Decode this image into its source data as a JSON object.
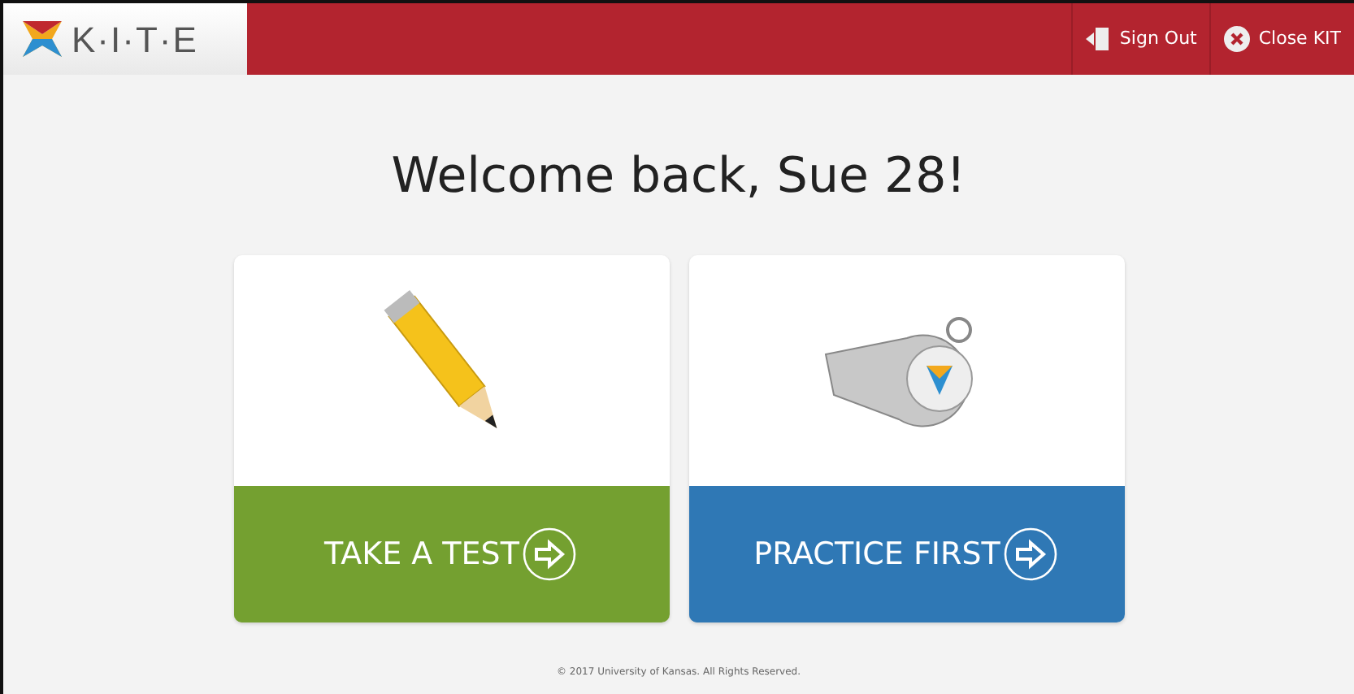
{
  "header": {
    "logo_text": "K·I·T·E",
    "actions": [
      {
        "kind": "signout",
        "label": "Sign Out"
      },
      {
        "kind": "close",
        "label": "Close KIT"
      }
    ]
  },
  "welcome": "Welcome back, Sue 28!",
  "cards": [
    {
      "kind": "pencil",
      "label": "TAKE A TEST",
      "color": "#74a030"
    },
    {
      "kind": "whistle",
      "label": "PRACTICE FIRST",
      "color": "#2f78b5"
    }
  ],
  "footer": "© 2017 University of Kansas. All Rights Reserved."
}
